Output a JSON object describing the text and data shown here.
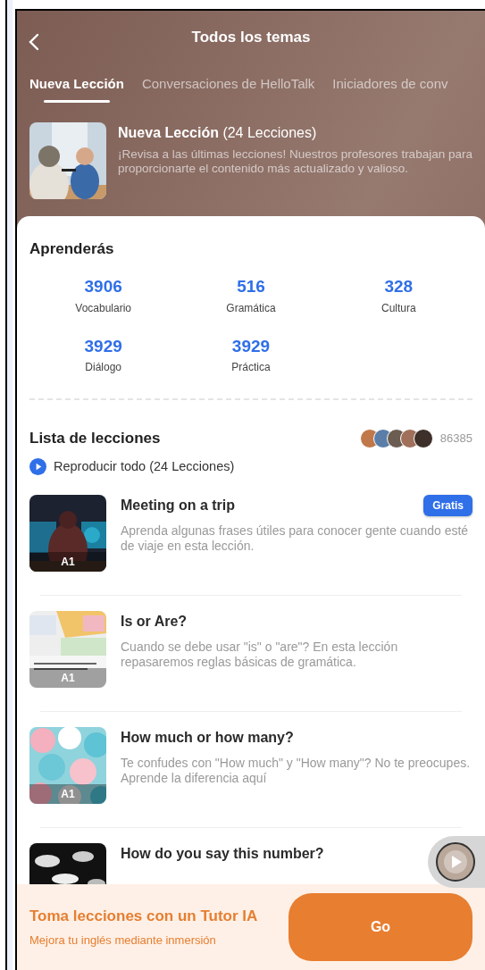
{
  "header": {
    "title": "Todos los temas"
  },
  "tabs": [
    {
      "label": "Nueva Lección",
      "selected": true
    },
    {
      "label": "Conversaciones de HelloTalk",
      "selected": false
    },
    {
      "label": "Iniciadores de conv",
      "selected": false
    }
  ],
  "course": {
    "title": "Nueva Lección",
    "count": "(24 Lecciones)",
    "description": "¡Revisa a las últimas lecciones! Nuestros profesores trabajan para proporcionarte el contenido más actualizado y valioso."
  },
  "learn": {
    "heading": "Aprenderás",
    "stats": [
      {
        "value": "3906",
        "label": "Vocabulario"
      },
      {
        "value": "516",
        "label": "Gramática"
      },
      {
        "value": "328",
        "label": "Cultura"
      },
      {
        "value": "3929",
        "label": "Diálogo"
      },
      {
        "value": "3929",
        "label": "Práctica"
      }
    ]
  },
  "lesson_list": {
    "heading": "Lista de lecciones",
    "learners": "86385",
    "play_all": "Reproducir todo (24 Lecciones)"
  },
  "lessons": [
    {
      "title": "Meeting on a trip",
      "description": "Aprenda algunas frases útiles para conocer gente cuando esté de viaje en esta lección.",
      "level": "A1",
      "badge": "Gratis"
    },
    {
      "title": "Is or Are?",
      "description": "Cuando se debe usar \"is\" o \"are\"? En esta lección repasaremos reglas básicas de gramática.",
      "level": "A1"
    },
    {
      "title": "How much or how many?",
      "description": "Te confudes con \"How much\" y \"How many\"? No te preocupes. Aprende la diferencia aquí",
      "level": "A1"
    },
    {
      "title": "How do you say this number?"
    }
  ],
  "promo": {
    "title": "Toma lecciones con un Tutor IA",
    "subtitle": "Mejora tu inglés mediante inmersión",
    "button": "Go"
  }
}
